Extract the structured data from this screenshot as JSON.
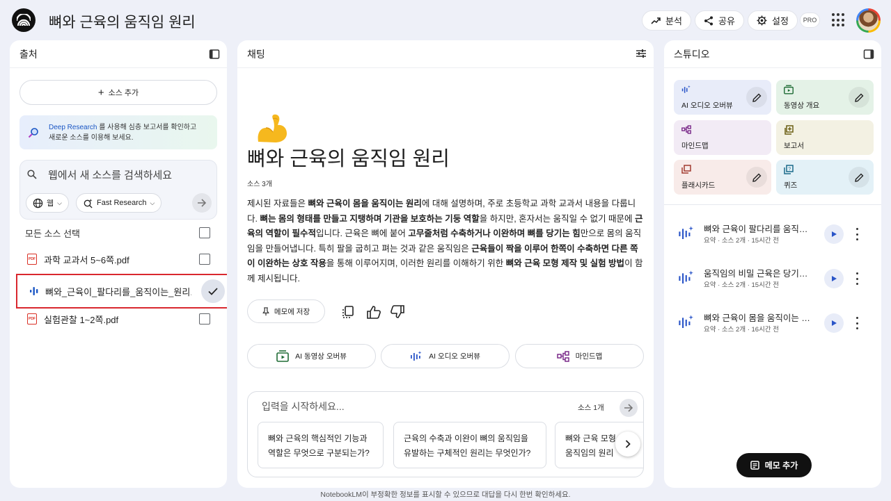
{
  "header": {
    "title": "뼈와 근육의 움직임 원리",
    "analysis_label": "분석",
    "share_label": "공유",
    "settings_label": "설정",
    "pro_badge": "PRO"
  },
  "sources": {
    "panel_title": "출처",
    "add_label": "소스 추가",
    "deep_research": {
      "link": "Deep Research",
      "text1": "를 사용해 심층 보고서를 확인하고",
      "text2": "새로운 소스를 이용해 보세요."
    },
    "search_placeholder": "웹에서 새 소스를 검색하세요",
    "web_chip": "웹",
    "research_chip": "Fast Research",
    "select_all": "모든 소스 선택",
    "items": [
      {
        "name": "과학 교과서 5~6쪽.pdf",
        "type": "pdf",
        "checked": false
      },
      {
        "name": "뼈와_근육이_팔다리를_움직이는_원리....",
        "type": "audio",
        "checked": true
      },
      {
        "name": "실험관찰 1~2쪽.pdf",
        "type": "pdf",
        "checked": false
      }
    ]
  },
  "chat": {
    "panel_title": "채팅",
    "title": "뼈와 근육의 움직임 원리",
    "source_count": "소스 3개",
    "save_memo": "메모에 저장",
    "buttons": [
      "AI 동영상 오버뷰",
      "AI 오디오 오버뷰",
      "마인드맵"
    ],
    "input_placeholder": "입력을 시작하세요...",
    "input_source_count": "소스 1개",
    "suggestions": [
      {
        "line1": "뼈와 근육의 핵심적인 기능과",
        "line2": "역할은 무엇으로 구분되는가?"
      },
      {
        "line1": "근육의 수축과 이완이 뼈의 움직임을",
        "line2": "유발하는 구체적인 원리는 무엇인가?"
      },
      {
        "line1": "뼈와 근육 모형",
        "line2": "움직임의 원리"
      }
    ]
  },
  "studio": {
    "panel_title": "스튜디오",
    "tiles": [
      {
        "label": "AI 오디오 오버뷰",
        "bg": "#e8ecf9"
      },
      {
        "label": "동영상 개요",
        "bg": "#e4f2e7"
      },
      {
        "label": "마인드맵",
        "bg": "#f2ebf5"
      },
      {
        "label": "보고서",
        "bg": "#f3f1e3"
      },
      {
        "label": "플래시카드",
        "bg": "#f8ebe9"
      },
      {
        "label": "퀴즈",
        "bg": "#e3f1f7"
      }
    ],
    "notes": [
      {
        "title": "뼈와 근육이 팔다리를 움직이는 원리",
        "sub": "요약 · 소스 2개 · 15시간 전"
      },
      {
        "title": "움직임의 비밀 근육은 당기기만 한다",
        "sub": "요약 · 소스 2개 · 15시간 전"
      },
      {
        "title": "뼈와 근육이 몸을 움직이는 원리",
        "sub": "요약 · 소스 2개 · 16시간 전"
      }
    ],
    "add_memo": "메모 추가"
  },
  "footer": "NotebookLM이 부정확한 정보를 표시할 수 있으므로 대답을 다시 한번 확인하세요."
}
